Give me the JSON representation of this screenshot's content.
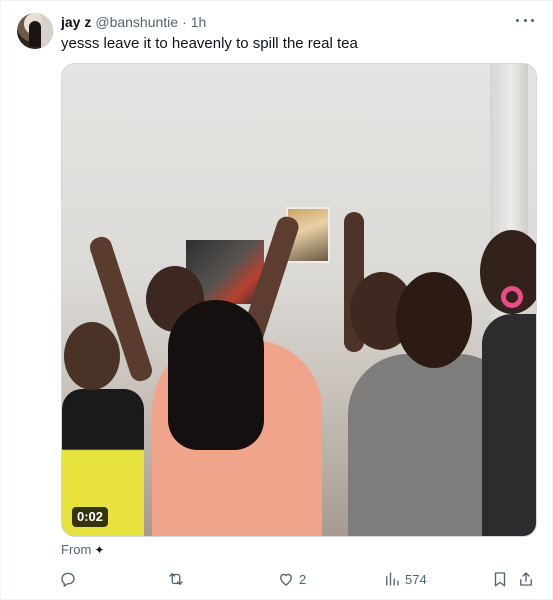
{
  "tweet": {
    "display_name": "jay z",
    "handle": "@banshuntie",
    "separator": "·",
    "time": "1h",
    "text": "yesss leave it to heavenly to spill the real tea",
    "media": {
      "kind": "video",
      "duration": "0:02"
    },
    "from_label": "From",
    "from_icon": "sparkle-icon",
    "actions": {
      "reply_count": "",
      "retweet_count": "",
      "like_count": "2",
      "views_count": "574"
    }
  },
  "icons": {
    "more": "more-horizontal-icon",
    "reply": "reply-icon",
    "retweet": "retweet-icon",
    "like": "heart-icon",
    "views": "views-icon",
    "bookmark": "bookmark-icon",
    "share": "share-icon"
  },
  "colors": {
    "text_primary": "#0f1419",
    "text_secondary": "#536471",
    "border": "#cfd9de"
  }
}
